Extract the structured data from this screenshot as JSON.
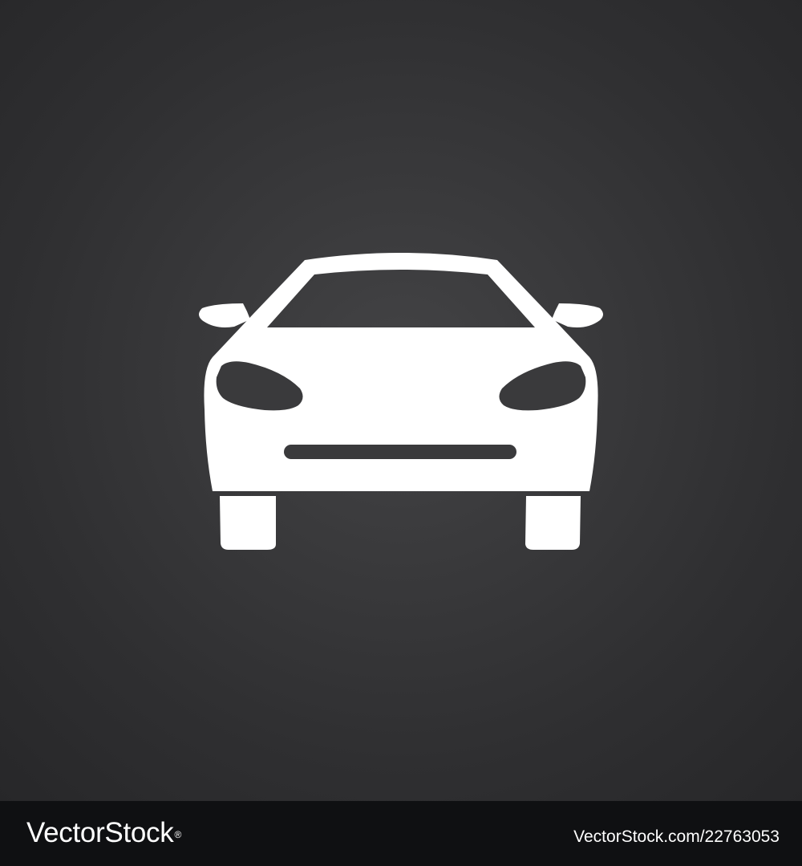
{
  "illustration": {
    "subject": "car-front-icon",
    "colors": {
      "icon": "#ffffff",
      "background_center": "#444446",
      "background_edge": "#262628",
      "footer": "#0f1012"
    }
  },
  "footer": {
    "logo_text": "VectorStock",
    "logo_mark": "®",
    "image_id": "VectorStock.com/22763053"
  }
}
